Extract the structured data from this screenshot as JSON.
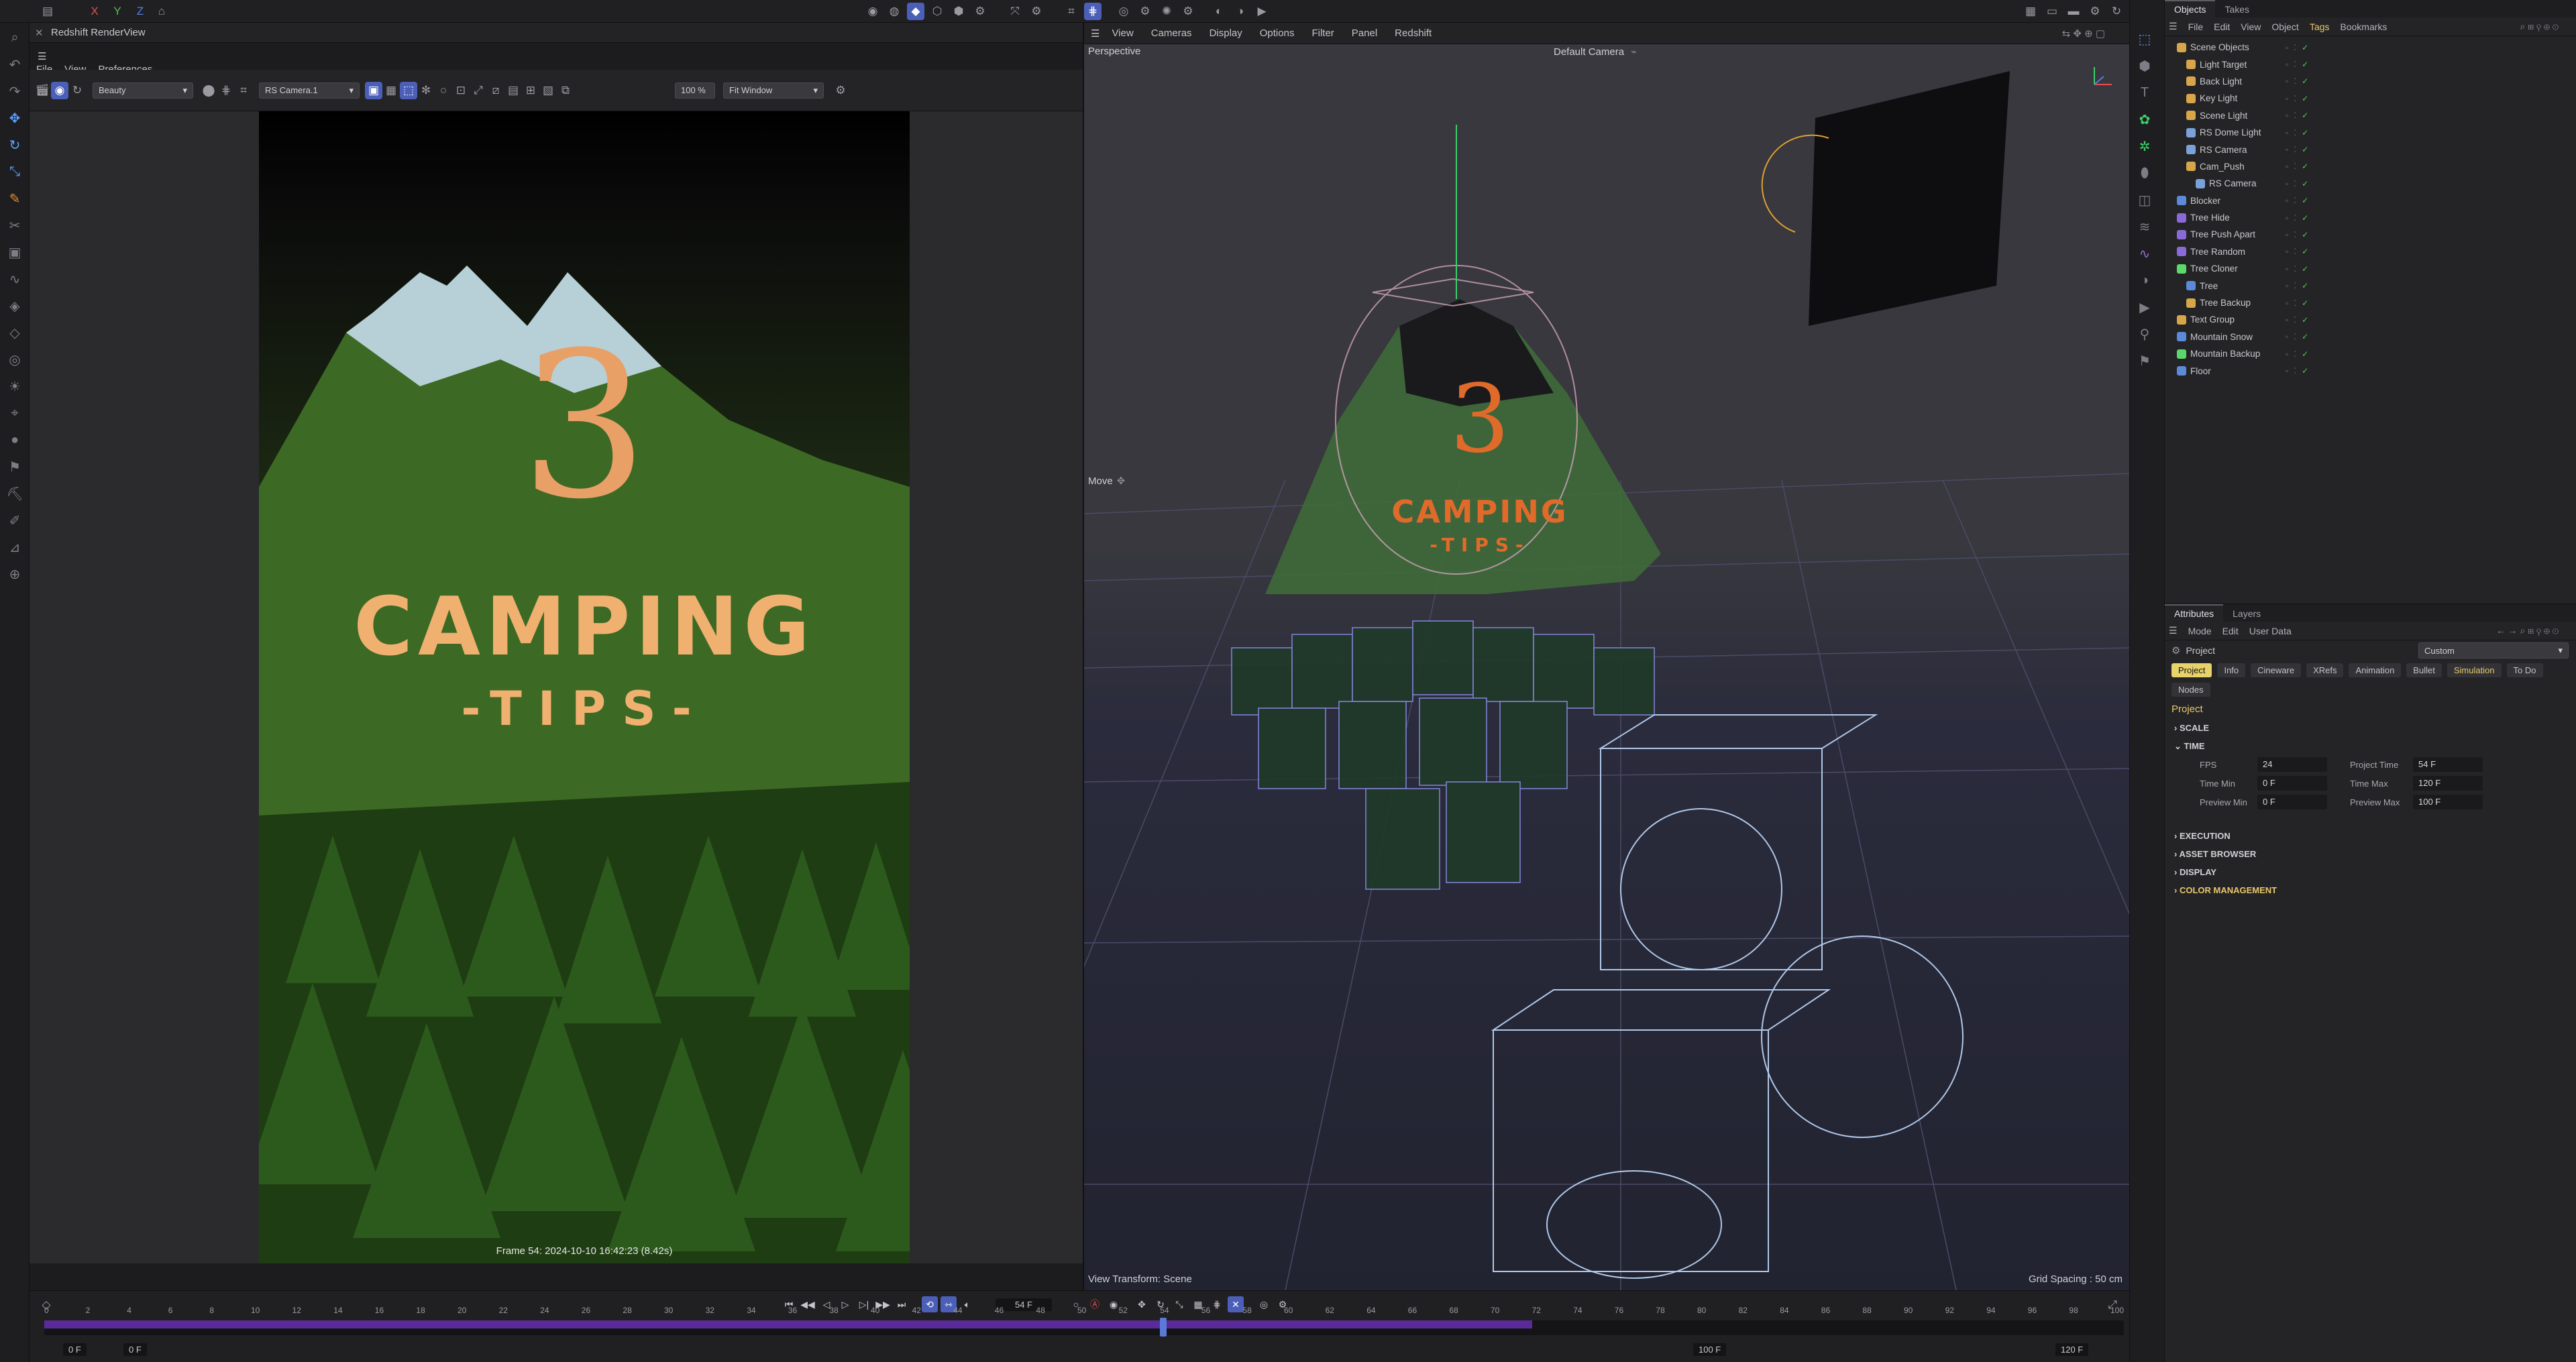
{
  "app": {
    "axis_x": "X",
    "axis_y": "Y",
    "axis_z": "Z"
  },
  "render_view": {
    "title": "Redshift RenderView",
    "menu": [
      "File",
      "View",
      "Preferences"
    ],
    "aov_select": "Beauty",
    "camera_select": "RS Camera.1",
    "zoom": "100 %",
    "fit_select": "Fit Window",
    "frame_info": "Frame 54:  2024-10-10  16:42:23  (8.42s)",
    "image": {
      "number": "3",
      "title": "CAMPING",
      "subtitle": "-TIPS-"
    }
  },
  "viewport": {
    "menu": [
      "View",
      "Cameras",
      "Display",
      "Options",
      "Filter",
      "Panel",
      "Redshift"
    ],
    "mode_label": "Perspective",
    "camera_label": "Default Camera",
    "tool_label": "Move",
    "view_transform": "View Transform: Scene",
    "grid_spacing": "Grid Spacing : 50 cm",
    "scene_text": {
      "number": "3",
      "title": "CAMPING",
      "subtitle": "-TIPS-"
    }
  },
  "objects_panel": {
    "tabs": [
      {
        "label": "Objects",
        "active": true
      },
      {
        "label": "Takes",
        "active": false
      }
    ],
    "menu": [
      "File",
      "Edit",
      "View",
      "Object",
      "Tags",
      "Bookmarks"
    ],
    "highlight_menu": "Tags",
    "items": [
      {
        "name": "Scene Objects",
        "indent": 0,
        "icon_color": "#d8a64a"
      },
      {
        "name": "Light Target",
        "indent": 1,
        "icon_color": "#d8a64a"
      },
      {
        "name": "Back Light",
        "indent": 1,
        "icon_color": "#d8a64a"
      },
      {
        "name": "Key Light",
        "indent": 1,
        "icon_color": "#d8a64a"
      },
      {
        "name": "Scene Light",
        "indent": 1,
        "icon_color": "#d8a64a"
      },
      {
        "name": "RS Dome Light",
        "indent": 1,
        "icon_color": "#7aa2d8"
      },
      {
        "name": "RS Camera",
        "indent": 1,
        "icon_color": "#7aa2d8"
      },
      {
        "name": "Cam_Push",
        "indent": 1,
        "icon_color": "#d8a64a"
      },
      {
        "name": "RS Camera",
        "indent": 2,
        "icon_color": "#7aa2d8"
      },
      {
        "name": "Blocker",
        "indent": 0,
        "icon_color": "#5a8ad8"
      },
      {
        "name": "Tree Hide",
        "indent": 0,
        "icon_color": "#8a6ad8"
      },
      {
        "name": "Tree Push Apart",
        "indent": 0,
        "icon_color": "#8a6ad8"
      },
      {
        "name": "Tree Random",
        "indent": 0,
        "icon_color": "#8a6ad8"
      },
      {
        "name": "Tree Cloner",
        "indent": 0,
        "icon_color": "#5ad86a"
      },
      {
        "name": "Tree",
        "indent": 1,
        "icon_color": "#5a8ad8"
      },
      {
        "name": "Tree Backup",
        "indent": 1,
        "icon_color": "#d8a64a"
      },
      {
        "name": "Text Group",
        "indent": 0,
        "icon_color": "#d8a64a"
      },
      {
        "name": "Mountain Snow",
        "indent": 0,
        "icon_color": "#5a8ad8"
      },
      {
        "name": "Mountain Backup",
        "indent": 0,
        "icon_color": "#5ad86a"
      },
      {
        "name": "Floor",
        "indent": 0,
        "icon_color": "#5a8ad8"
      }
    ]
  },
  "attributes_panel": {
    "tabs": [
      {
        "label": "Attributes",
        "active": true
      },
      {
        "label": "Layers",
        "active": false
      }
    ],
    "menu": [
      "Mode",
      "Edit",
      "User Data"
    ],
    "object_label": "Project",
    "preset_select": "Custom",
    "buttons": [
      {
        "label": "Project",
        "active": true
      },
      {
        "label": "Info",
        "active": false
      },
      {
        "label": "Cineware",
        "active": false
      },
      {
        "label": "XRefs",
        "active": false
      },
      {
        "label": "Animation",
        "active": false
      },
      {
        "label": "Bullet",
        "active": false
      },
      {
        "label": "Simulation",
        "active": false
      },
      {
        "label": "To Do",
        "active": false
      },
      {
        "label": "Nodes",
        "active": false
      }
    ],
    "section_title": "Project",
    "sections": {
      "scale": "SCALE",
      "time": "TIME",
      "execution": "EXECUTION",
      "asset_browser": "ASSET BROWSER",
      "display": "DISPLAY",
      "color_management": "COLOR MANAGEMENT"
    },
    "time_fields": {
      "fps_label": "FPS",
      "fps": "24",
      "project_time_label": "Project Time",
      "project_time": "54 F",
      "time_min_label": "Time Min",
      "time_min": "0 F",
      "time_max_label": "Time Max",
      "time_max": "120 F",
      "preview_min_label": "Preview Min",
      "preview_min": "0 F",
      "preview_max_label": "Preview Max",
      "preview_max": "100 F"
    }
  },
  "timeline": {
    "current_frame": "54 F",
    "ticks": [
      0,
      2,
      4,
      6,
      8,
      10,
      12,
      14,
      16,
      18,
      20,
      22,
      24,
      26,
      28,
      30,
      32,
      34,
      36,
      38,
      40,
      42,
      44,
      46,
      48,
      50,
      52,
      54,
      56,
      58,
      60,
      62,
      64,
      66,
      68,
      70,
      72,
      74,
      76,
      78,
      80,
      82,
      84,
      86,
      88,
      90,
      92,
      94,
      96,
      98,
      100
    ],
    "range_end": 72,
    "playhead": 54,
    "start_field": "0 F",
    "start_field2": "0 F",
    "preview_end_field": "100 F",
    "end_field": "120 F",
    "range_color": "#5a2a9a"
  }
}
